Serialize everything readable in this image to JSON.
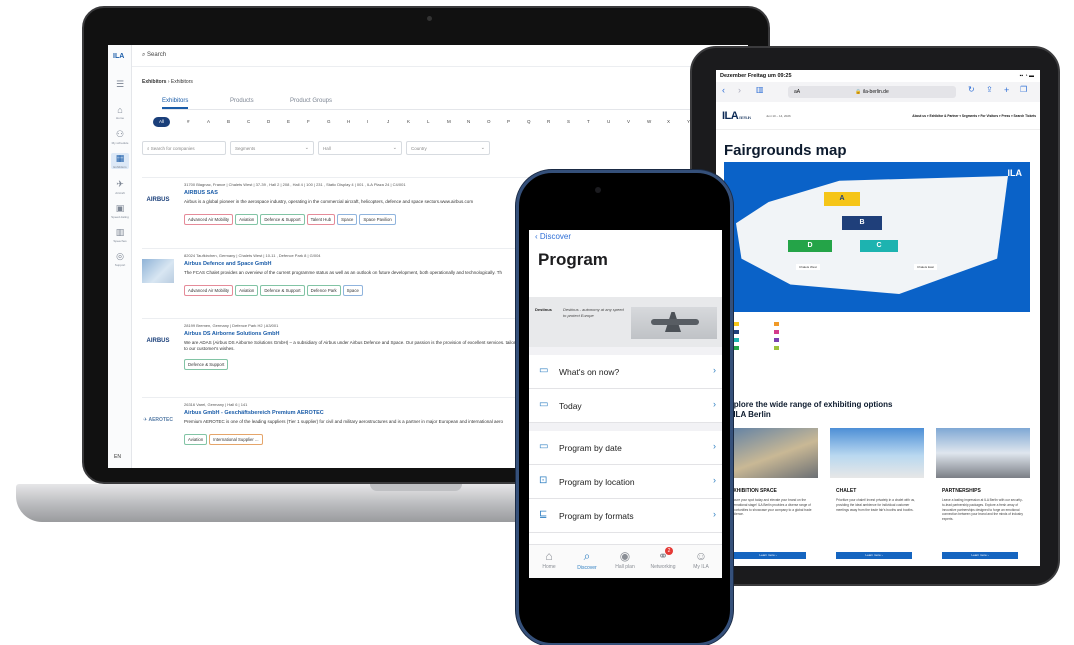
{
  "laptop": {
    "logo": "ILA",
    "search_label": "Search",
    "breadcrumb": {
      "root": "Exhibitors",
      "sep": "›",
      "current": "Exhibitors"
    },
    "sidebar": [
      {
        "icon": "⌂",
        "label": "Home"
      },
      {
        "icon": "⚇",
        "label": "My schedule"
      },
      {
        "icon": "▦",
        "label": "Exhibitors"
      },
      {
        "icon": "✈",
        "label": "Aircraft"
      },
      {
        "icon": "▣",
        "label": "Speed dating"
      },
      {
        "icon": "▥",
        "label": "Speeches"
      },
      {
        "icon": "◎",
        "label": "Support"
      }
    ],
    "language": "EN",
    "tabs": [
      "Exhibitors",
      "Products",
      "Product Groups"
    ],
    "alphabet": {
      "all_label": "All",
      "letters": [
        "#",
        "A",
        "B",
        "C",
        "D",
        "E",
        "F",
        "G",
        "H",
        "I",
        "J",
        "K",
        "L",
        "M",
        "N",
        "O",
        "P",
        "Q",
        "R",
        "S",
        "T",
        "U",
        "V",
        "W",
        "X",
        "Y"
      ]
    },
    "filters": {
      "search_placeholder": "Search for companies",
      "segments": "Segments",
      "hall": "Hall",
      "country": "Country"
    },
    "companies": [
      {
        "logo": "AIRBUS",
        "meta": "31700 Blagnac, France | Chalets West | 37-39 , Hall 2 | 208 , Hall 4 | 100 | 231 , Static Display 4 | 001 , ILA Plaza 24 | C4/001",
        "name": "AIRBUS SAS",
        "desc": "Airbus is a global pioneer in the aerospace industry, operating in the commercial aircraft, helicopters, defence and space sectors.www.airbus.com",
        "tags": [
          "Advanced Air Mobility",
          "Aviation",
          "Defence & Support",
          "Talent Hub",
          "Space",
          "Space Pavilion"
        ]
      },
      {
        "logo": "",
        "meta": "82024 Taufkirchen, Germany | Chalets West | 10-11 , Defence Park 8 | G/004",
        "name": "Airbus Defence and Space GmbH",
        "desc": "The FCAS Chalet provides an overview of the current programme status as well as an outlook on future development, both operationally and technologically. Th",
        "tags": [
          "Advanced Air Mobility",
          "Aviation",
          "Defence & Support",
          "Defence Park",
          "Space"
        ]
      },
      {
        "logo": "AIRBUS",
        "meta": "28199 Bremen, Germany | Defence Park H2 | A3/001",
        "name": "Airbus DS Airborne Solutions GmbH",
        "desc": "We are ADAS (Airbus DS Airborne Solutions GmbH) – a subsidiary of Airbus under Airbus Defence and Space. Our passion is the provision of excellent services. tailored to our customer's wishes.",
        "tags": [
          "Defence & Support"
        ]
      },
      {
        "logo": "AEROTEC",
        "meta": "26316 Varel, Germany | Hall 6 | 141",
        "name": "Airbus GmbH - Geschäftsbereich Premium AEROTEC",
        "desc": "Premium AEROTEC is one of the leading suppliers (Tier 1 supplier) for civil and military aerostructures and is a partner in major European and international aero",
        "tags": [
          "Aviation",
          "International Supplier ..."
        ]
      }
    ]
  },
  "tablet": {
    "status_left": "Dezember Freitag um 09:25",
    "status_right": "▪▪ ◔ ▬",
    "font_size_label": "aA",
    "url": "🔒 ila-berlin.de",
    "logo": "ILA",
    "logo_sub": "BERLIN",
    "date_line": "Juni 10 – 14, 2026",
    "nav": "About us ▾   Exhibitor & Partner ▾   Segments ▾   For Visitors ▾   Press ▾   Search   Tickets",
    "fairgrounds_title": "Fairgrounds map",
    "map": {
      "logo": "ILA",
      "halls": [
        "A",
        "B",
        "C",
        "D"
      ],
      "chalets_west": "Chalets West",
      "chalets_east": "Chalets East"
    },
    "explore_title": "Explore the wide range of exhibiting options at ILA Berlin",
    "cards": [
      {
        "title": "EXHIBITION SPACE",
        "text": "Secure your spot today and elevate your brand on the international stage! ILA Berlin provides a diverse range of opportunities to showcase your company to a global trade audience.",
        "button": "Learn more ›"
      },
      {
        "title": "CHALET",
        "text": "Prioritize your chalet! Invest privately in a chalet with us, providing the ideal ambience for individual customer meetings away from the trade fair's booths and booths.",
        "button": "Learn more ›"
      },
      {
        "title": "PARTNERSHIPS",
        "text": "Leave a lasting impression at ILA Berlin with our security-to-lead partnership packages. Explore a fresh array of innovative partnerships designed to forge an emotional connection between your brand and the minds of industry experts.",
        "button": "Learn more ›"
      }
    ]
  },
  "phone": {
    "back_label": "Discover",
    "title": "Program",
    "banner_brand": "Destinus",
    "banner_text": "Destinus - autonomy at any speed to protect Europe",
    "items": [
      {
        "icon": "▭",
        "label": "What's on now?"
      },
      {
        "icon": "▭",
        "label": "Today"
      },
      {
        "icon": "▭",
        "label": "Program by date"
      },
      {
        "icon": "⊡",
        "label": "Program by location"
      },
      {
        "icon": "⊑",
        "label": "Program by formats"
      }
    ],
    "tabbar": [
      {
        "icon": "⌂",
        "label": "Home"
      },
      {
        "icon": "⌕",
        "label": "Discover"
      },
      {
        "icon": "◉",
        "label": "Hall plan"
      },
      {
        "icon": "⚭",
        "label": "Networking",
        "badge": "2"
      },
      {
        "icon": "☺",
        "label": "My ILA"
      }
    ],
    "chevron": "›"
  },
  "colors": {
    "ila_blue": "#1a5ca8",
    "map_blue": "#0a62c8",
    "hall_yellow": "#f5c518",
    "hall_navy": "#1f3f7a",
    "hall_teal": "#1db3b0",
    "hall_green": "#24a448",
    "phone_frame": "#35507a"
  }
}
